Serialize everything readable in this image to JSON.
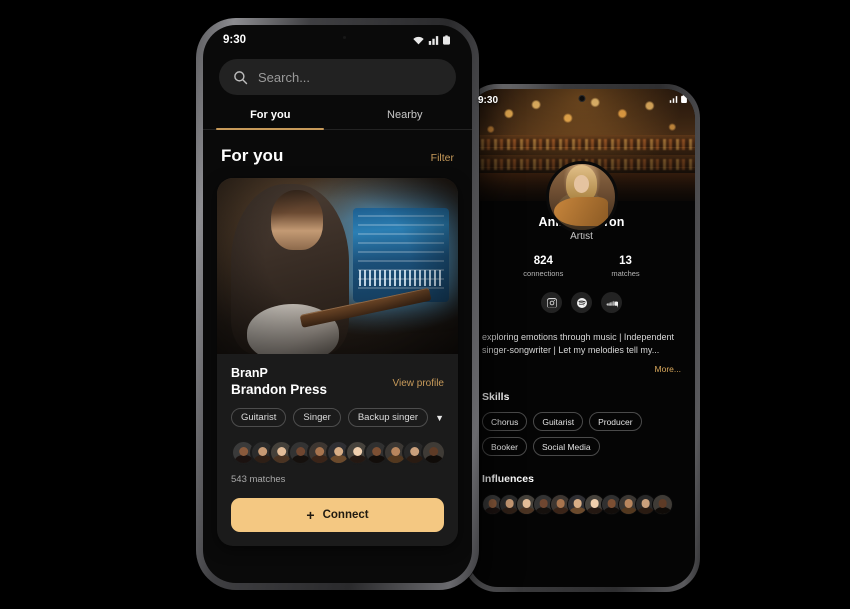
{
  "left_phone": {
    "status": {
      "time": "9:30",
      "icons": [
        "wifi-icon",
        "signal-icon",
        "battery-icon"
      ]
    },
    "search": {
      "placeholder": "Search...",
      "icon": "search-icon"
    },
    "tabs": [
      {
        "label": "For you",
        "active": true
      },
      {
        "label": "Nearby",
        "active": false
      }
    ],
    "section": {
      "title": "For you",
      "filter_label": "Filter"
    },
    "card": {
      "photo_alt": "musician-playing-guitar-in-studio",
      "handle": "BranP",
      "full_name": "Brandon Press",
      "view_profile_label": "View profile",
      "tags": [
        "Guitarist",
        "Singer",
        "Backup singer"
      ],
      "expand_icon": "chevron-down-icon",
      "matches_count_label": "543 matches",
      "match_avatars": 11,
      "connect_label": "Connect",
      "connect_icon": "plus-icon"
    }
  },
  "right_phone": {
    "status": {
      "time": "9:30"
    },
    "cover_alt": "bar-interior-with-edison-bulbs",
    "profile": {
      "avatar_alt": "woman-with-acoustic-guitar",
      "name": "Anika Siphron",
      "role": "Artist",
      "stats": [
        {
          "value": "824",
          "label": "connections"
        },
        {
          "value": "13",
          "label": "matches"
        }
      ],
      "socials": [
        "instagram-icon",
        "spotify-icon",
        "soundcloud-icon"
      ],
      "bio": "exploring emotions through music | Independent\nsinger-songwriter | Let my melodies tell my...",
      "bio_line1": "exploring emotions through music | Independent",
      "bio_line2": "singer-songwriter | Let my melodies tell my...",
      "more_label": "More...",
      "skills_title": "Skills",
      "skills": [
        "Chorus",
        "Guitarist",
        "Producer",
        "Booker",
        "Social Media"
      ],
      "influences_title": "Influences",
      "influences_count": 11
    }
  },
  "colors": {
    "accent": "#c79a5a",
    "connect_button": "#f4c882",
    "background": "#000000",
    "screen": "#0a0a0a",
    "card": "#1b1b1b",
    "search_field": "#222222"
  }
}
